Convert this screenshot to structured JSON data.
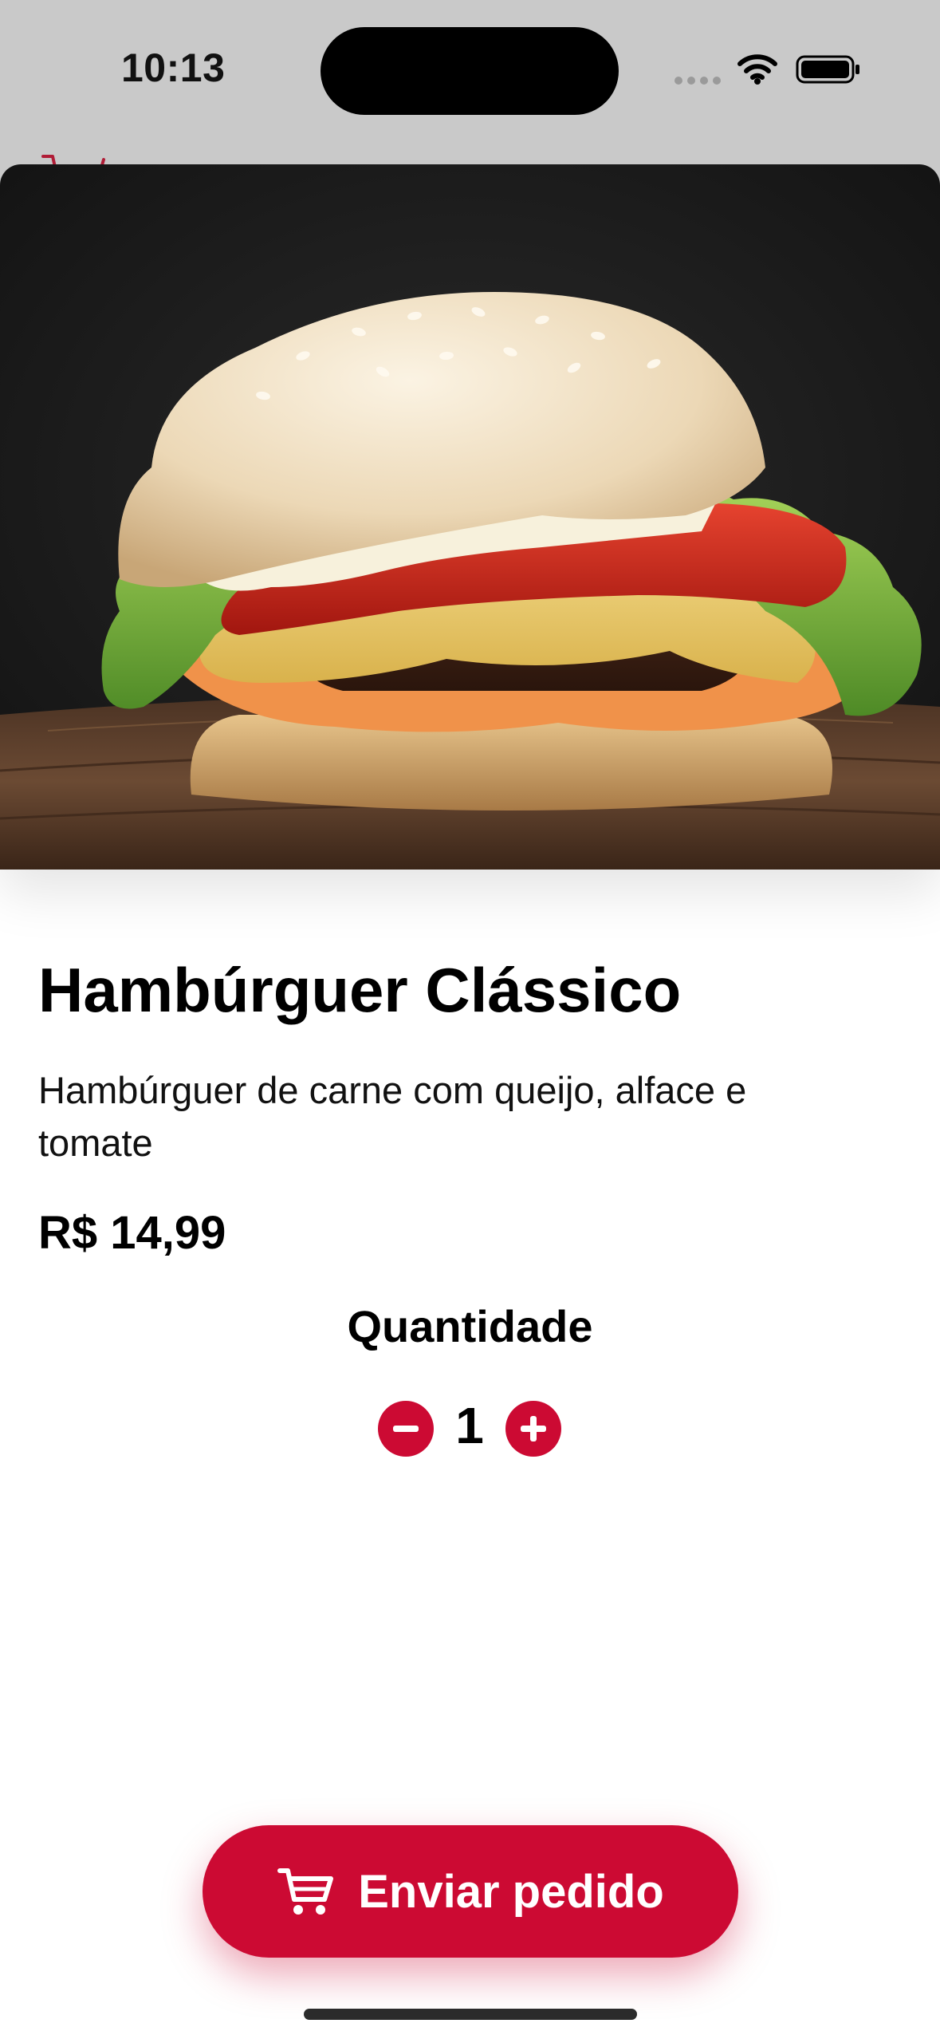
{
  "status_bar": {
    "time": "10:13"
  },
  "product": {
    "image_alt": "Hambúrguer com queijo, alface e tomate",
    "name": "Hambúrguer Clássico",
    "description": "Hambúrguer de carne com queijo, alface e tomate",
    "price": "R$ 14,99"
  },
  "quantity": {
    "label": "Quantidade",
    "value": "1",
    "decrement_icon": "minus-circle-icon",
    "increment_icon": "plus-circle-icon"
  },
  "actions": {
    "submit_label": "Enviar pedido",
    "submit_icon": "cart-icon"
  },
  "colors": {
    "accent": "#cc0a33",
    "background": "#ffffff",
    "text": "#000000"
  }
}
